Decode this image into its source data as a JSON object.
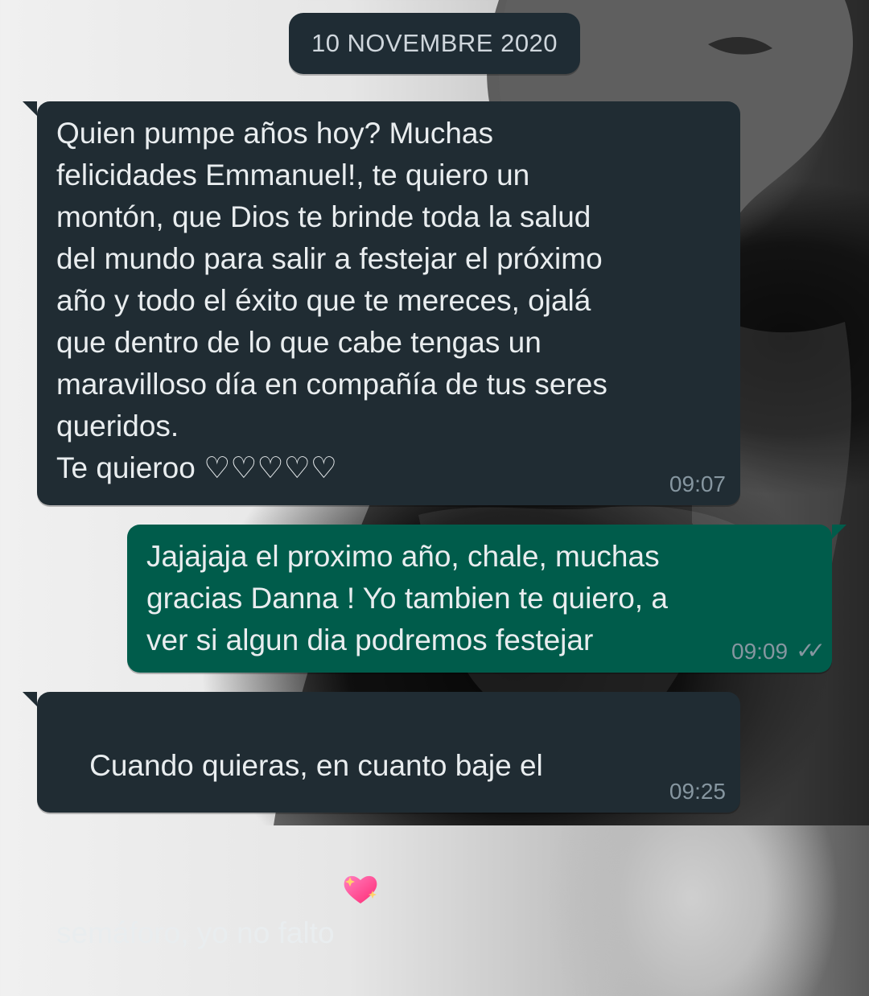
{
  "date_label": "10 NOVEMBRE 2020",
  "messages": [
    {
      "direction": "incoming",
      "text": "Quien pumpe años hoy? Muchas\nfelicidades Emmanuel!, te quiero un\nmontón, que Dios te brinde toda la salud\ndel mundo para salir a festejar el próximo\naño y todo el éxito que te mereces, ojalá\nque dentro de lo que cabe tengas un\nmaravilloso día en compañía de tus seres\nqueridos.\nTe quieroo ♡♡♡♡♡",
      "time": "09:07"
    },
    {
      "direction": "outgoing",
      "text": "Jajajaja el proximo año, chale, muchas\ngracias Danna ! Yo tambien te quiero, a\nver si algun dia podremos festejar",
      "time": "09:09",
      "status_icon": "double-check-icon"
    },
    {
      "direction": "incoming",
      "text": "Cuando quieras, en cuanto baje el\nsemáforo, yo no falto",
      "emoji": "💖",
      "time": "09:25"
    }
  ],
  "colors": {
    "incoming_bubble": "#202c33",
    "outgoing_bubble": "#005c4b",
    "text": "#e9edef",
    "timestamp": "#8696a0",
    "date_chip": "#1f2c34"
  },
  "icons": {
    "double_check": "double-check-icon",
    "sparkling_heart": "sparkling-heart-icon"
  }
}
